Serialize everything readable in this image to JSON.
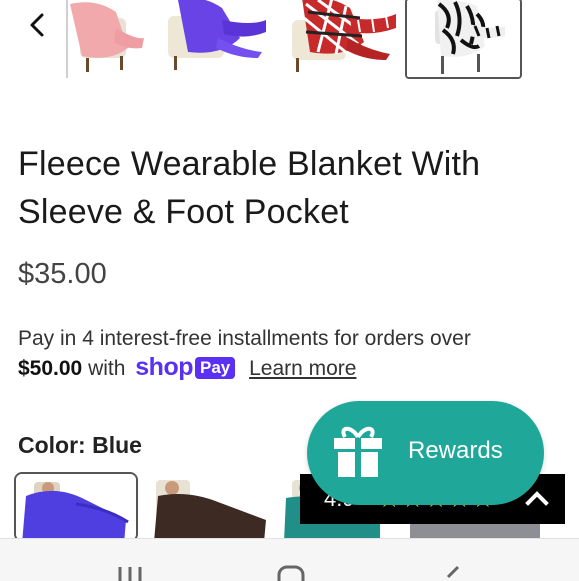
{
  "product": {
    "title": "Fleece Wearable Blanket With Sleeve & Foot Pocket",
    "price": "$35.00"
  },
  "installments": {
    "text_prefix": "Pay in 4 interest-free installments for orders over",
    "threshold": "$50.00",
    "with_text": "with",
    "shop_logo": "shop",
    "pay_badge": "Pay",
    "learn_more": "Learn more"
  },
  "color": {
    "label": "Color:",
    "selected": "Blue",
    "swatches": [
      {
        "name": "Blue",
        "hex": "#4f3fe0"
      },
      {
        "name": "Brown",
        "hex": "#3d2a22"
      },
      {
        "name": "Teal",
        "hex": "#1f8f87"
      },
      {
        "name": "Gray",
        "hex": "#8d8f94"
      }
    ]
  },
  "gallery": {
    "thumbs": [
      {
        "name": "pink",
        "hex": "#f2a9ac"
      },
      {
        "name": "purple",
        "hex": "#6a43e6"
      },
      {
        "name": "red-plaid",
        "hex": "#c62a2a"
      },
      {
        "name": "zebra",
        "hex": "#222222"
      }
    ],
    "selected_index": 3
  },
  "rewards": {
    "label": "Rewards"
  },
  "rating": {
    "score": "4.9",
    "stars": "★★★★★"
  },
  "colors": {
    "accent_teal": "#1fa89a",
    "shop_purple": "#5a31f4",
    "star_yellow": "#f4c20d"
  },
  "icons": [
    "chevron-left-icon",
    "gift-icon",
    "chevron-up-icon",
    "recent-apps-icon",
    "home-icon",
    "back-icon"
  ]
}
